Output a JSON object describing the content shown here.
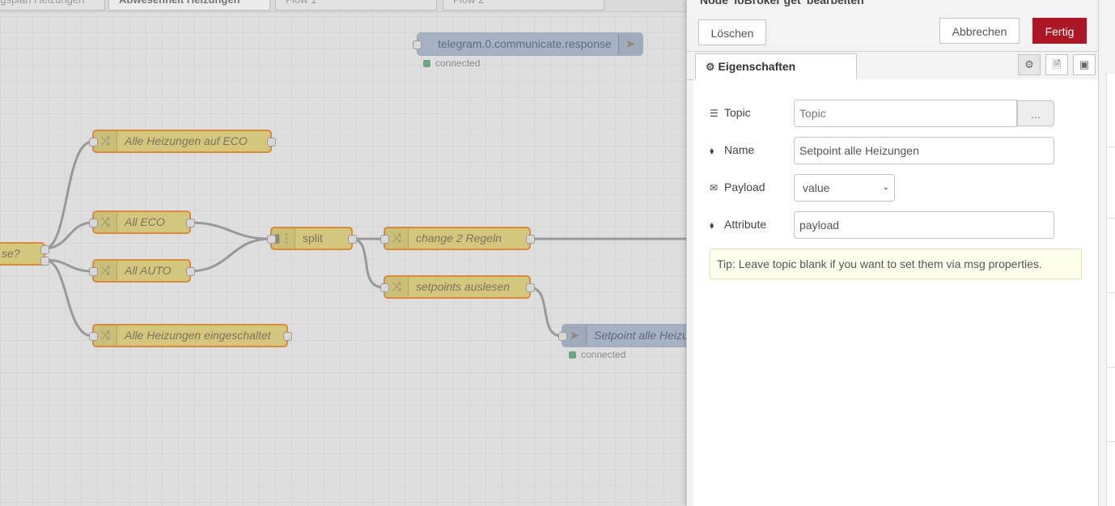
{
  "workspace": {
    "tabs": [
      {
        "label": "ngsplan Heizungen"
      },
      {
        "label": "Abwesenheit Heizungen"
      },
      {
        "label": "Flow 1"
      },
      {
        "label": "Flow 2"
      }
    ],
    "nodes": {
      "switch_partial": "se?",
      "eco_all": "Alle Heizungen auf ECO",
      "all_eco": "All ECO",
      "all_auto": "All AUTO",
      "all_on": "Alle Heizungen eingeschaltet",
      "split": "split",
      "change_rules": "change 2 Regeln",
      "read_setpoints": "setpoints auslesen",
      "telegram": "telegram.0.communicate.response",
      "setpoint_out": "Setpoint alle Heizungen"
    },
    "status_connected": "connected"
  },
  "editor": {
    "title": "Node 'ioBroker get' bearbeiten",
    "delete_label": "Löschen",
    "cancel_label": "Abbrechen",
    "done_label": "Fertig",
    "tab_properties": "Eigenschaften",
    "fields": {
      "topic_label": "Topic",
      "topic_placeholder": "Topic",
      "topic_browse": "...",
      "name_label": "Name",
      "name_value": "Setpoint alle Heizungen",
      "payload_label": "Payload",
      "payload_value": "value",
      "attribute_label": "Attribute",
      "attribute_value": "payload"
    },
    "tip": "Tip: Leave topic blank if you want to set them via msg properties."
  }
}
